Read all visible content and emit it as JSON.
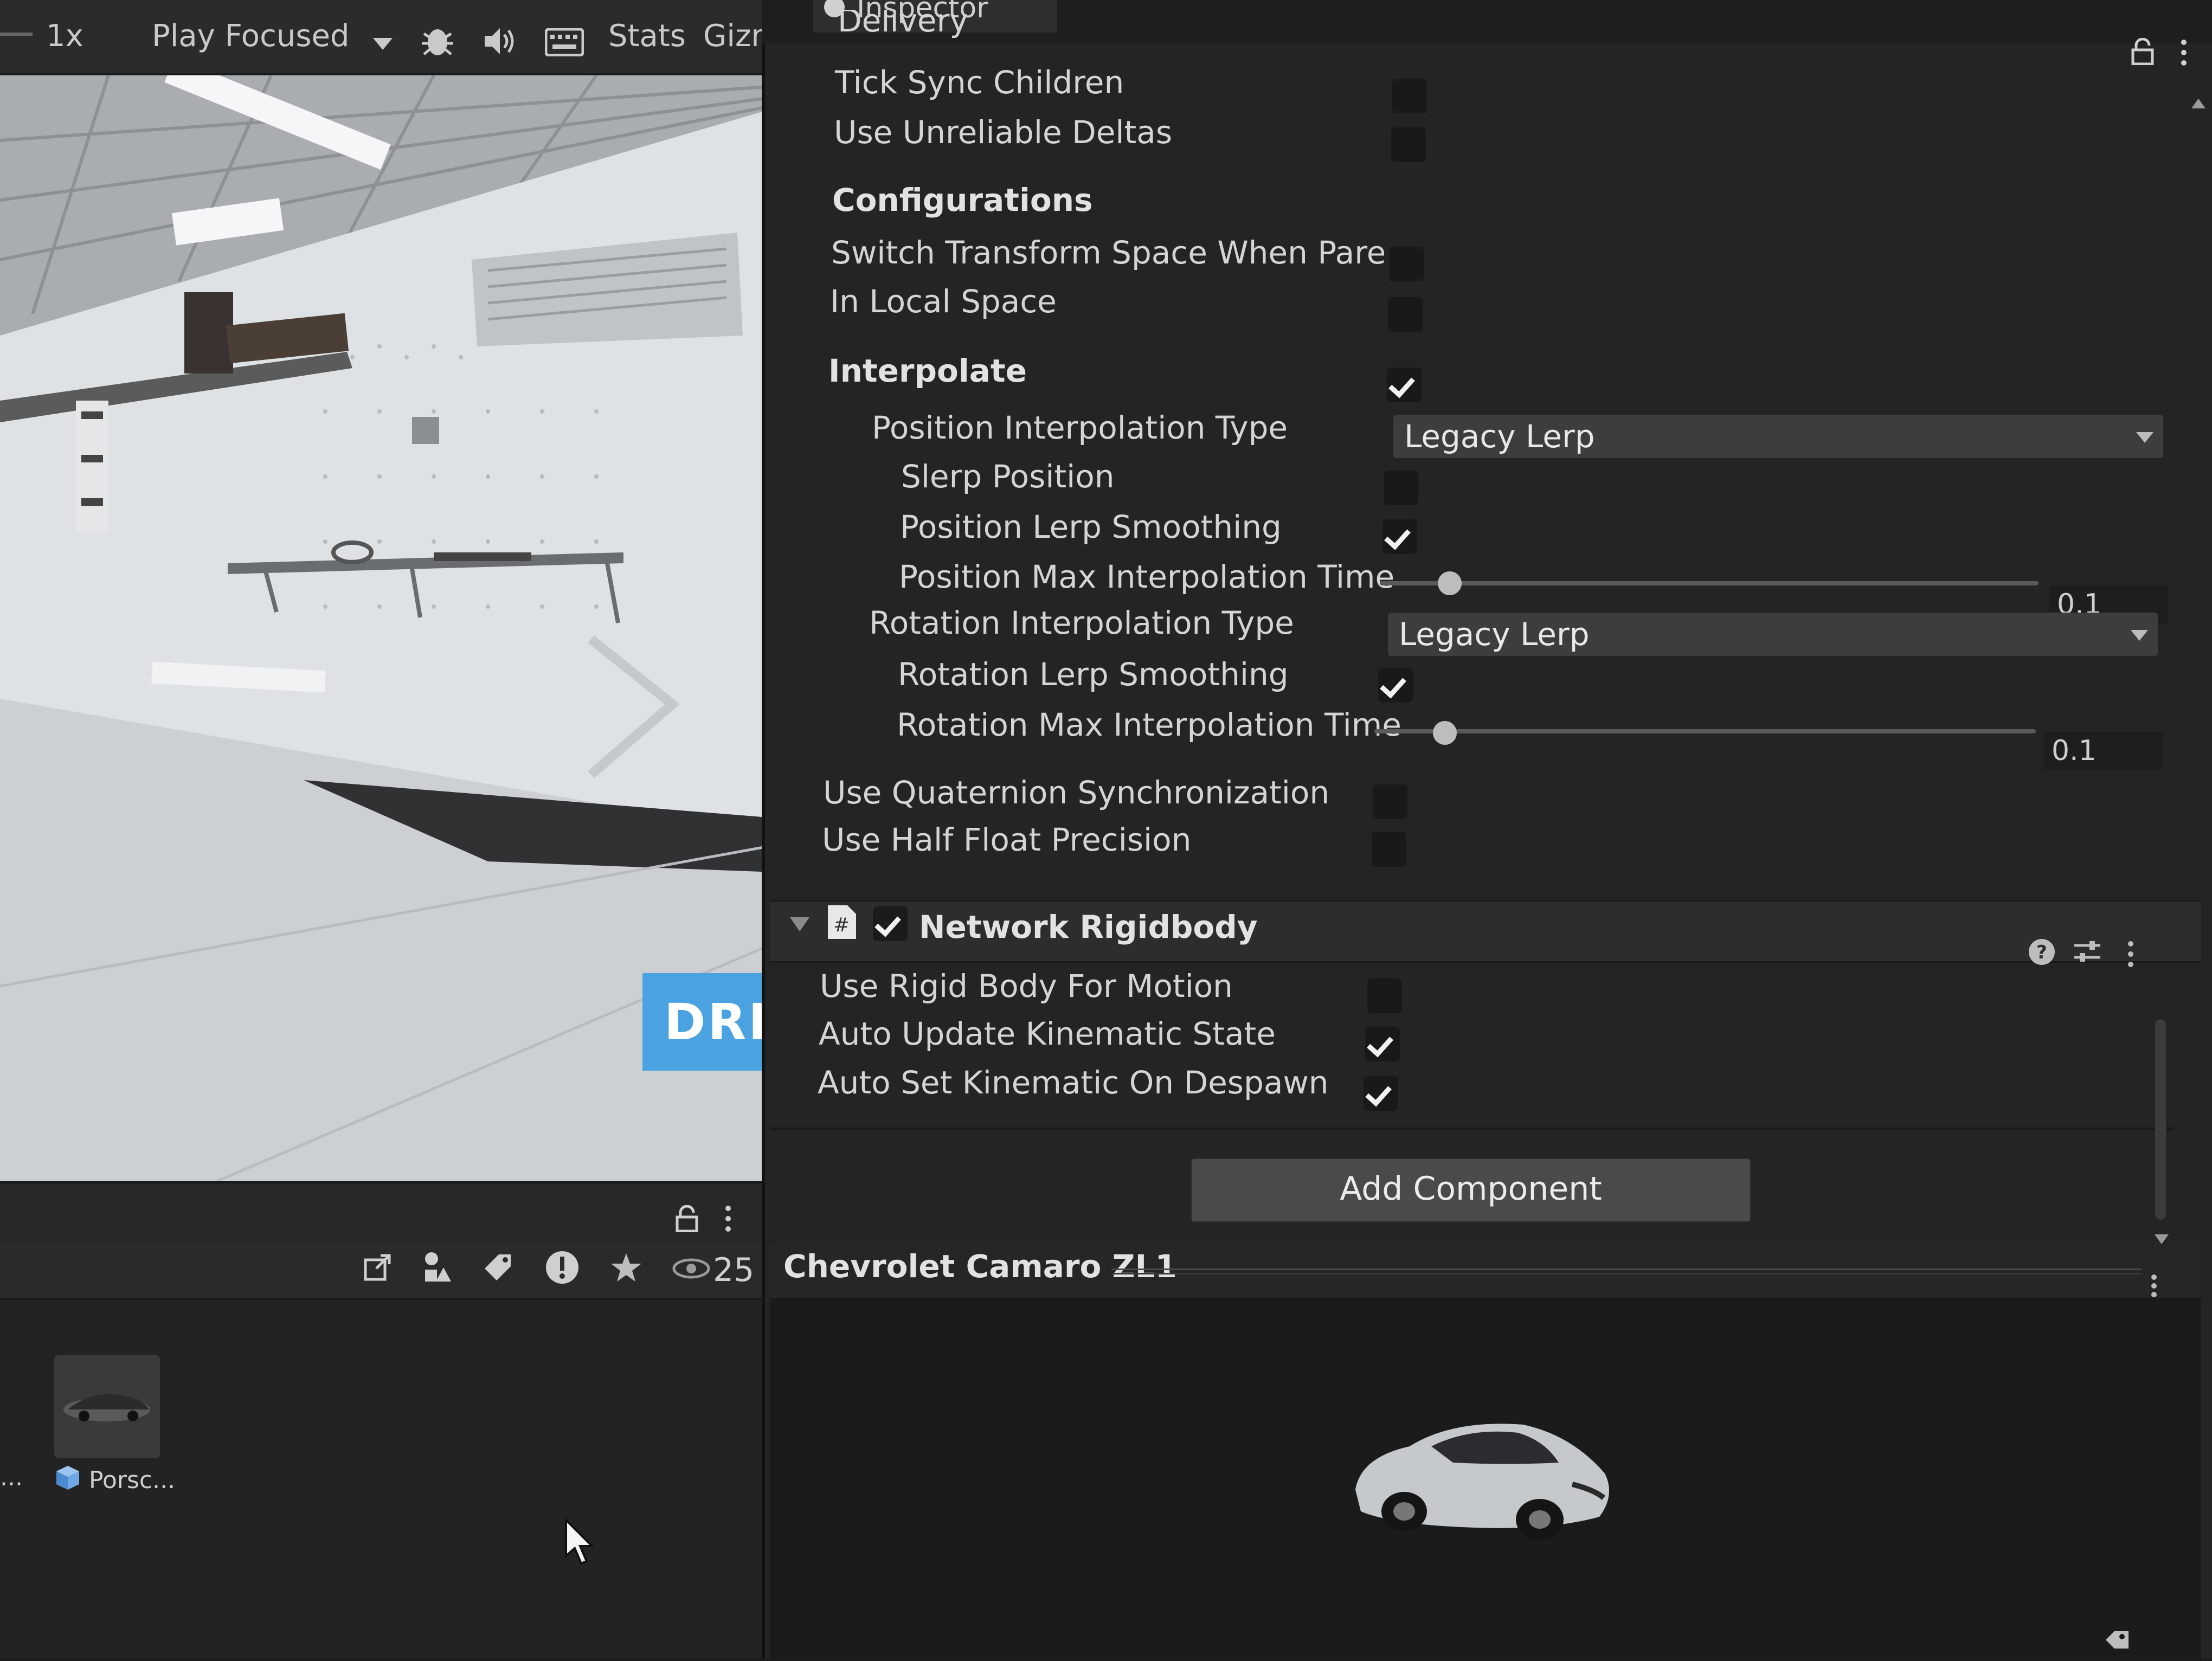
{
  "game_toolbar": {
    "scale": "1x",
    "play_mode": "Play Focused",
    "stats_label": "Stats",
    "gizmos_label": "Gizmc"
  },
  "game_view": {
    "sign_text": "DRIV"
  },
  "project": {
    "hidden_count": "25",
    "assets": [
      {
        "label": "Porsc..."
      }
    ],
    "prev_label": "..."
  },
  "inspector": {
    "tab_title": "Inspector",
    "section_cut": "Delivery",
    "rows": {
      "tick_sync_children": {
        "label": "Tick Sync Children",
        "checked": false
      },
      "use_unreliable_deltas": {
        "label": "Use Unreliable Deltas",
        "checked": false
      },
      "configurations": "Configurations",
      "switch_transform_space": {
        "label": "Switch Transform Space When Parente",
        "checked": false
      },
      "in_local_space": {
        "label": "In Local Space",
        "checked": false
      },
      "interpolate": {
        "label": "Interpolate",
        "checked": true
      },
      "position_interpolation_type": {
        "label": "Position Interpolation Type",
        "value": "Legacy Lerp"
      },
      "slerp_position": {
        "label": "Slerp Position",
        "checked": false
      },
      "position_lerp_smoothing": {
        "label": "Position Lerp Smoothing",
        "checked": true
      },
      "position_max_interpolation_time": {
        "label": "Position Max Interpolation Time",
        "value": "0.1",
        "fraction": 0.1
      },
      "rotation_interpolation_type": {
        "label": "Rotation Interpolation Type",
        "value": "Legacy Lerp"
      },
      "rotation_lerp_smoothing": {
        "label": "Rotation Lerp Smoothing",
        "checked": true
      },
      "rotation_max_interpolation_time": {
        "label": "Rotation Max Interpolation Time",
        "value": "0.1",
        "fraction": 0.1
      },
      "use_quaternion_sync": {
        "label": "Use Quaternion Synchronization",
        "checked": false
      },
      "use_half_float": {
        "label": "Use Half Float Precision",
        "checked": false
      }
    },
    "network_rigidbody": {
      "title": "Network Rigidbody",
      "enabled": true,
      "use_rigid_body_for_motion": {
        "label": "Use Rigid Body For Motion",
        "checked": false
      },
      "auto_update_kinematic_state": {
        "label": "Auto Update Kinematic State",
        "checked": true
      },
      "auto_set_kinematic_on_despawn": {
        "label": "Auto Set Kinematic On Despawn",
        "checked": true
      }
    },
    "add_component": "Add Component",
    "preview_title": "Chevrolet Camaro ZL1"
  },
  "colors": {
    "background": "#242424",
    "accent_sign": "#4aa3e0"
  }
}
